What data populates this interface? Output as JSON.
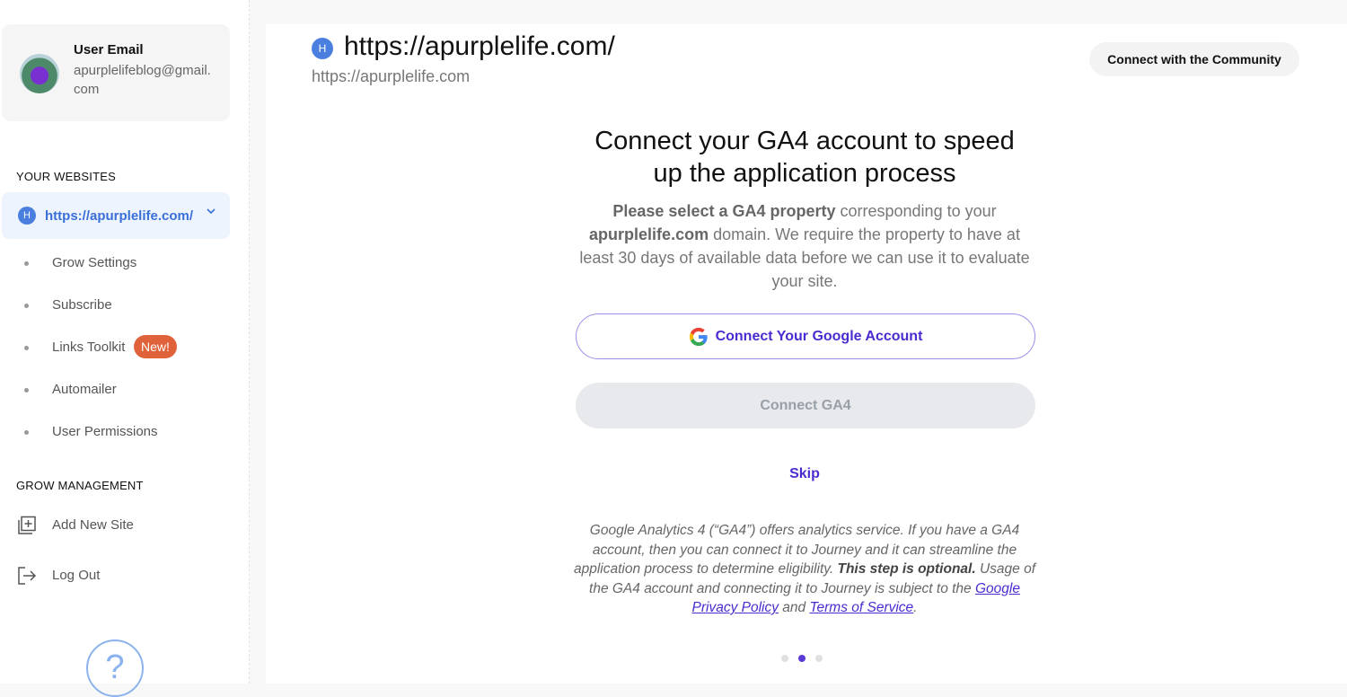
{
  "user": {
    "label": "User Email",
    "email": "apurplelifeblog@gmail.com"
  },
  "sidebar": {
    "websites_heading": "YOUR WEBSITES",
    "site": {
      "badge": "H",
      "name": "https://apurplelife.com/"
    },
    "items": [
      {
        "label": "Grow Settings"
      },
      {
        "label": "Subscribe"
      },
      {
        "label": "Links Toolkit",
        "badge": "New!"
      },
      {
        "label": "Automailer"
      },
      {
        "label": "User Permissions"
      }
    ],
    "management_heading": "GROW MANAGEMENT",
    "management": [
      {
        "label": "Add New Site",
        "icon": "add-square-icon"
      },
      {
        "label": "Log Out",
        "icon": "logout-icon"
      }
    ],
    "help_glyph": "?"
  },
  "header": {
    "badge": "H",
    "title": "https://apurplelife.com/",
    "subtitle": "https://apurplelife.com",
    "community_button": "Connect with the Community"
  },
  "main": {
    "heading_line1": "Connect your GA4 account to speed",
    "heading_line2": "up the application process",
    "desc": {
      "bold1": "Please select a GA4 property",
      "text1": " corresponding to your ",
      "bold2": "apurplelife.com",
      "text2": " domain. We require the property to have at least 30 days of available data before we can use it to evaluate your site."
    },
    "google_button": "Connect Your Google Account",
    "ga4_button": "Connect GA4",
    "skip": "Skip",
    "fine": {
      "text1": "Google Analytics 4 (“GA4”) offers analytics service. If you have a GA4 account, then you can connect it to Journey and it can streamline the application process to determine eligibility. ",
      "bold": "This step is optional.",
      "text2": " Usage of the GA4 account and connecting it to Journey is subject to the ",
      "link1": "Google Privacy Policy",
      "text3": " and ",
      "link2": "Terms of Service",
      "text4": "."
    },
    "steps": {
      "total": 3,
      "active": 2
    }
  },
  "colors": {
    "accent": "#4b2bcf",
    "site_blue": "#4a7fe0",
    "badge_orange": "#e0623a"
  }
}
